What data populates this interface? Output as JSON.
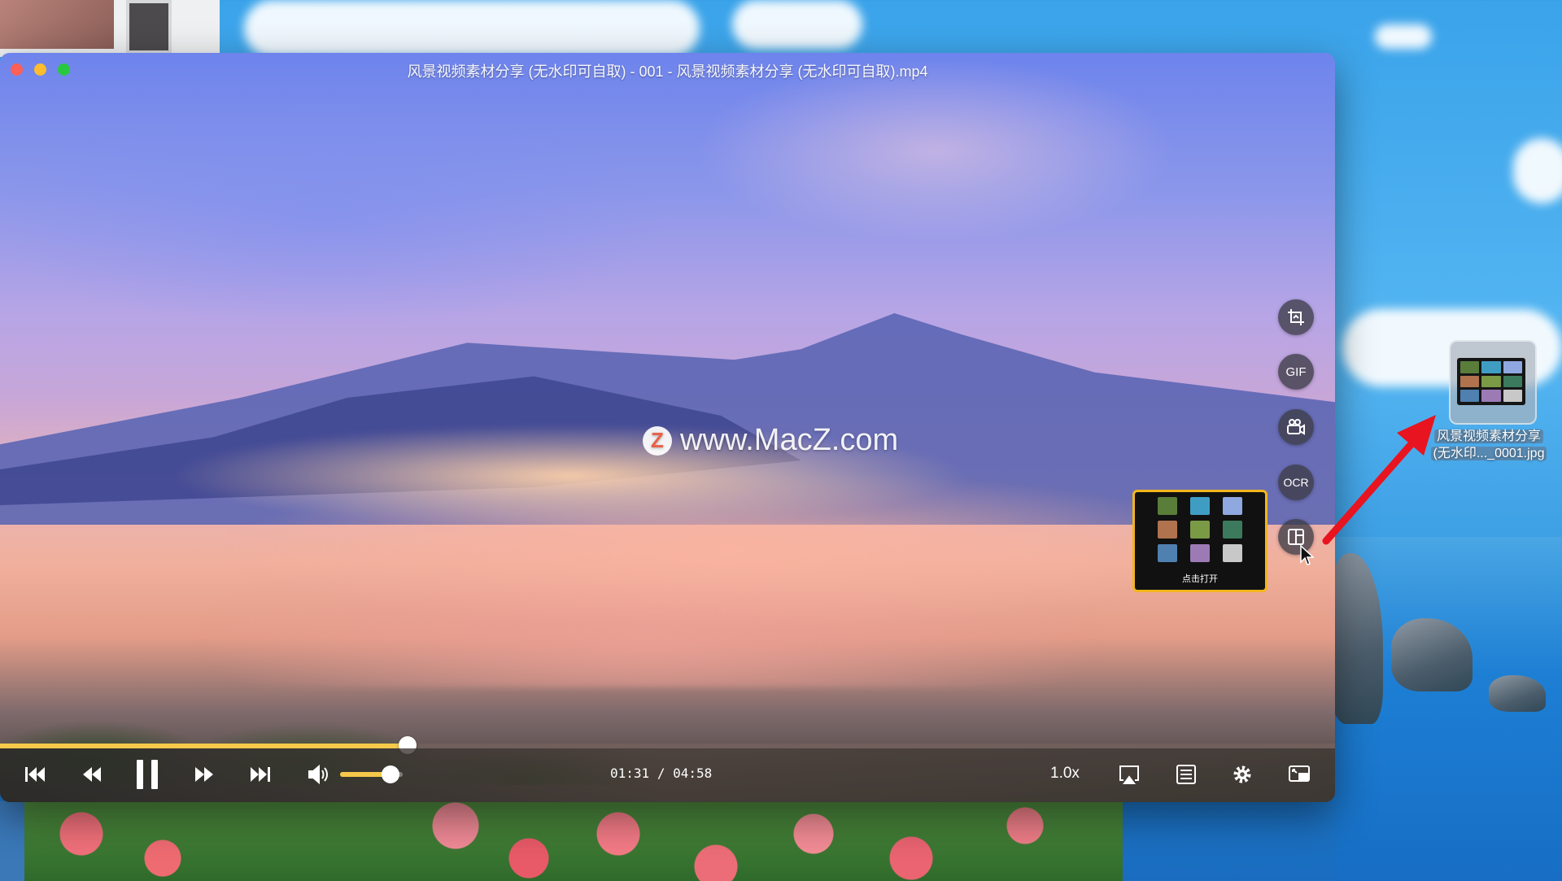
{
  "window": {
    "title": "风景视频素材分享 (无水印可自取) - 001 - 风景视频素材分享 (无水印可自取).mp4"
  },
  "watermark": {
    "logo_letter": "Z",
    "text": "www.MacZ.com"
  },
  "side_tools": {
    "crop": "crop-icon",
    "gif_label": "GIF",
    "record": "video-record-icon",
    "ocr_label": "OCR",
    "thumbnails": "thumbnail-grid-icon"
  },
  "thumbnail_popup": {
    "label": "点击打开",
    "colors": [
      "#5a7d3a",
      "#3f9dc4",
      "#8fa8e0",
      "#b0734d",
      "#7a9a45",
      "#3c7a5e",
      "#4f80b0",
      "#9c7bb5",
      "#c8c8c8"
    ]
  },
  "controls": {
    "current_time": "01:31",
    "separator": "/",
    "total_time": "04:58",
    "progress": 0.305,
    "volume": 0.8,
    "speed": "1.0x",
    "icons": [
      "skip-previous-icon",
      "rewind-icon",
      "pause-icon",
      "fast-forward-icon",
      "skip-next-icon",
      "volume-icon",
      "airplay-icon",
      "playlist-icon",
      "settings-icon",
      "picture-in-picture-icon"
    ]
  },
  "desktop_file": {
    "name_line1": "风景视频素材分享",
    "name_line2": "(无水印..._0001.jpg"
  },
  "colors": {
    "accent": "#f6c94a",
    "arrow": "#e8141f",
    "popup_border": "#f2b51d"
  }
}
